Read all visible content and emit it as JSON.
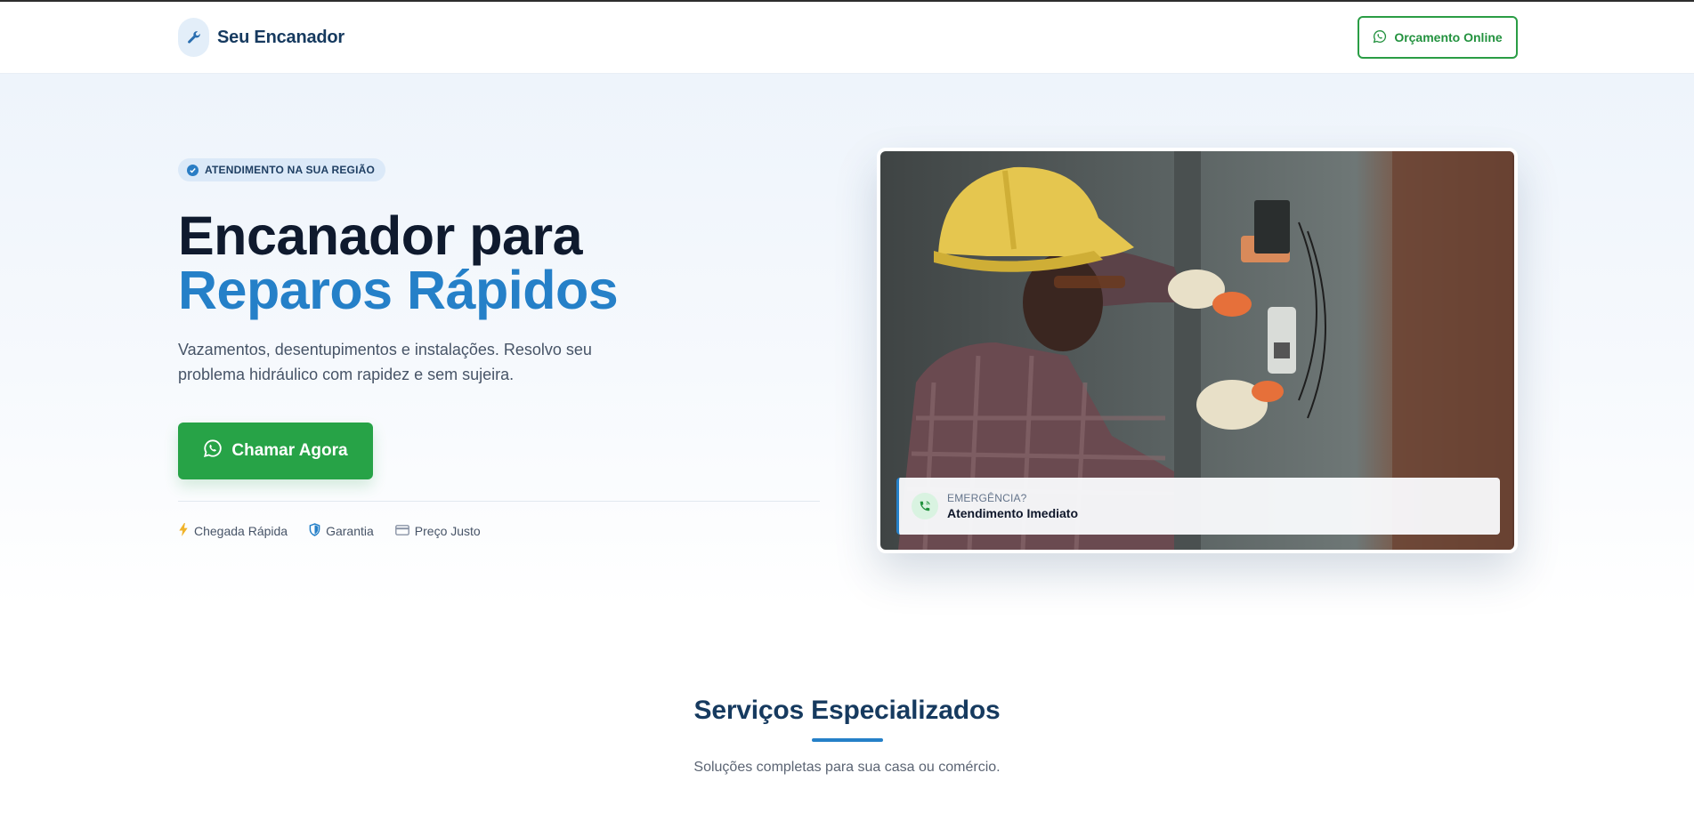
{
  "header": {
    "brand_name": "Seu Encanador",
    "budget_button": "Orçamento Online"
  },
  "hero": {
    "badge": "ATENDIMENTO NA SUA REGIÃO",
    "title_line1": "Encanador para",
    "title_line2": "Reparos Rápidos",
    "lead": "Vazamentos, desentupimentos e instalações. Resolvo seu problema hidráulico com rapidez e sem sujeira.",
    "cta": "Chamar Agora",
    "features": [
      "Chegada Rápida",
      "Garantia",
      "Preço Justo"
    ]
  },
  "card": {
    "emergency_kicker": "EMERGÊNCIA?",
    "emergency_title": "Atendimento Imediato"
  },
  "services": {
    "title": "Serviços Especializados",
    "subtitle": "Soluções completas para sua casa ou comércio."
  },
  "colors": {
    "primary_blue": "#2580c8",
    "navy": "#163a5f",
    "whatsapp_green": "#27a347"
  },
  "icons": [
    "wrench-icon",
    "whatsapp-icon",
    "check-circle-icon",
    "lightning-icon",
    "shield-icon",
    "credit-card-icon",
    "phone-call-icon"
  ]
}
